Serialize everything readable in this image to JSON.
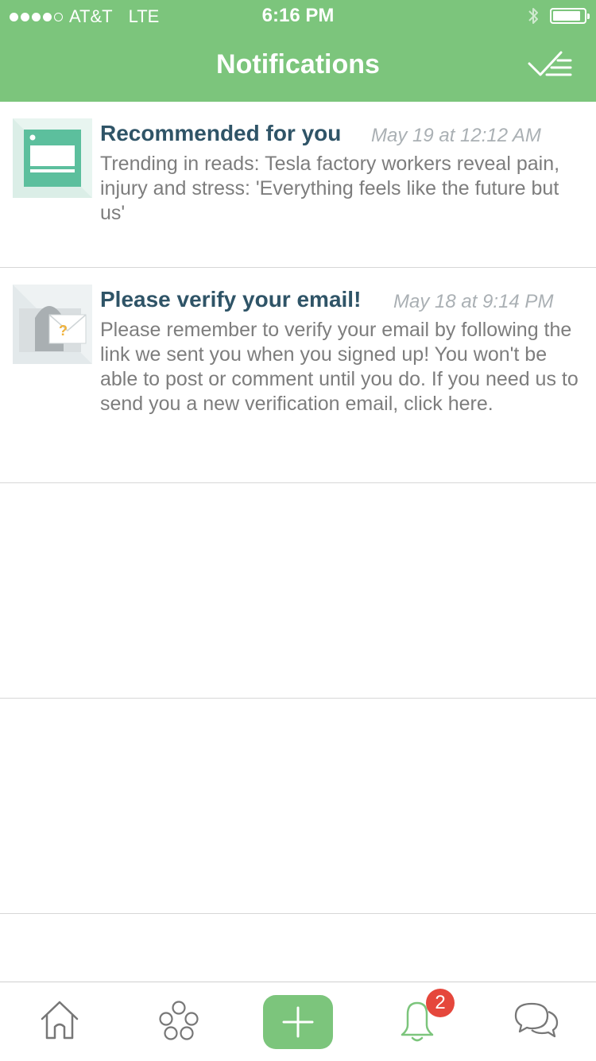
{
  "status_bar": {
    "carrier": "AT&T",
    "network": "LTE",
    "time": "6:16 PM"
  },
  "header": {
    "title": "Notifications"
  },
  "notifications": [
    {
      "title": "Recommended for you",
      "time": "May 19 at 12:12 AM",
      "body": "Trending in reads: Tesla factory workers reveal pain, injury and stress: 'Everything feels like the future but us'",
      "icon": "article-icon"
    },
    {
      "title": "Please verify your email!",
      "time": "May 18 at 9:14 PM",
      "body": "Please remember to verify your email by following the link we sent you when you signed up! You won't be able to post or comment until you do. If you need us to send you a new verification email, click here.",
      "icon": "email-verify-icon"
    }
  ],
  "tabbar": {
    "notifications_badge": "2"
  },
  "colors": {
    "brand_green": "#7cc57c",
    "title_navy": "#2f5467",
    "badge_red": "#e5473c"
  }
}
